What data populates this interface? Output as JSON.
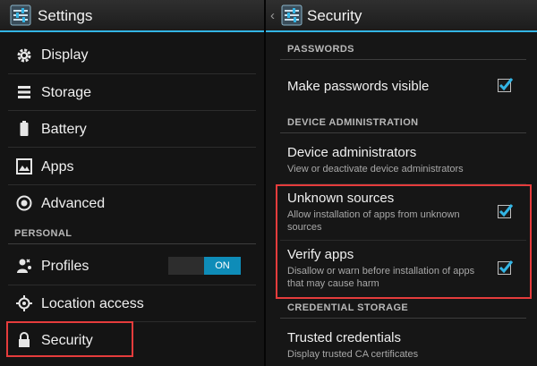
{
  "colors": {
    "accent": "#33b5e5",
    "highlight": "#e53c3c",
    "toggle_on": "#0e8cb8"
  },
  "left": {
    "title": "Settings",
    "icon": "settings-app-icon",
    "items": [
      {
        "label": "Display",
        "icon": "display-gear-icon"
      },
      {
        "label": "Storage",
        "icon": "storage-icon"
      },
      {
        "label": "Battery",
        "icon": "battery-icon"
      },
      {
        "label": "Apps",
        "icon": "apps-icon"
      },
      {
        "label": "Advanced",
        "icon": "advanced-icon"
      }
    ],
    "personal_header": "PERSONAL",
    "personal_items": [
      {
        "label": "Profiles",
        "icon": "profiles-icon",
        "toggle": "ON"
      },
      {
        "label": "Location access",
        "icon": "location-icon"
      },
      {
        "label": "Security",
        "icon": "lock-icon",
        "selected": true
      }
    ]
  },
  "right": {
    "back": "‹",
    "title": "Security",
    "icon": "settings-app-icon",
    "passwords_header": "PASSWORDS",
    "make_passwords_visible": {
      "label": "Make passwords visible",
      "checked": true
    },
    "device_admin_header": "DEVICE ADMINISTRATION",
    "device_administrators": {
      "label": "Device administrators",
      "summary": "View or deactivate device administrators"
    },
    "unknown_sources": {
      "label": "Unknown sources",
      "summary": "Allow installation of apps from unknown sources",
      "checked": true
    },
    "verify_apps": {
      "label": "Verify apps",
      "summary": "Disallow or warn before installation of apps that may cause harm",
      "checked": true
    },
    "credential_header": "CREDENTIAL STORAGE",
    "trusted_credentials": {
      "label": "Trusted credentials",
      "summary": "Display trusted CA certificates"
    }
  }
}
